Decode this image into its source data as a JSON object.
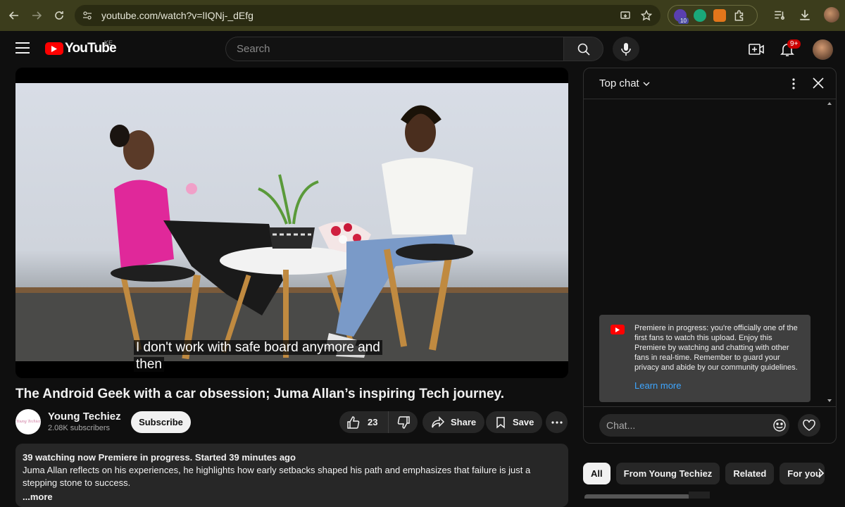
{
  "browser": {
    "url": "youtube.com/watch?v=lIQNj-_dEfg",
    "extension_badge": "10"
  },
  "header": {
    "logo_text": "YouTube",
    "country_code": "KE",
    "search_placeholder": "Search",
    "notification_count": "9+"
  },
  "video": {
    "caption_line1": "I don't work with safe board anymore and",
    "caption_line2": "then",
    "title": "The Android Geek with a car obsession; Juma Allan’s inspiring Tech journey.",
    "channel_name": "Young Techiez",
    "channel_avatar_text": "Young Techiez",
    "subscribers": "2.08K subscribers",
    "subscribe_label": "Subscribe",
    "like_count": "23",
    "share_label": "Share",
    "save_label": "Save",
    "description_meta": "39 watching now  Premiere in progress. Started 39 minutes ago",
    "description_text": "Juma Allan reflects on his experiences, he highlights how early setbacks shaped his path and emphasizes that failure is just a stepping stone to success.",
    "description_more": "...more"
  },
  "chat": {
    "mode_label": "Top chat",
    "premiere_message": "Premiere in progress: you're officially one of the first fans to watch this upload. Enjoy this Premiere by watching and chatting with other fans in real-time. Remember to guard your privacy and abide by our community guidelines.",
    "learn_more_label": "Learn more",
    "input_placeholder": "Chat..."
  },
  "chips": [
    {
      "label": "All",
      "active": true
    },
    {
      "label": "From Young Techiez",
      "active": false
    },
    {
      "label": "Related",
      "active": false
    },
    {
      "label": "For you",
      "active": false
    }
  ],
  "colors": {
    "brand_red": "#ff0000",
    "link_blue": "#3ea6ff",
    "browser_bar": "#3c3d1c"
  }
}
